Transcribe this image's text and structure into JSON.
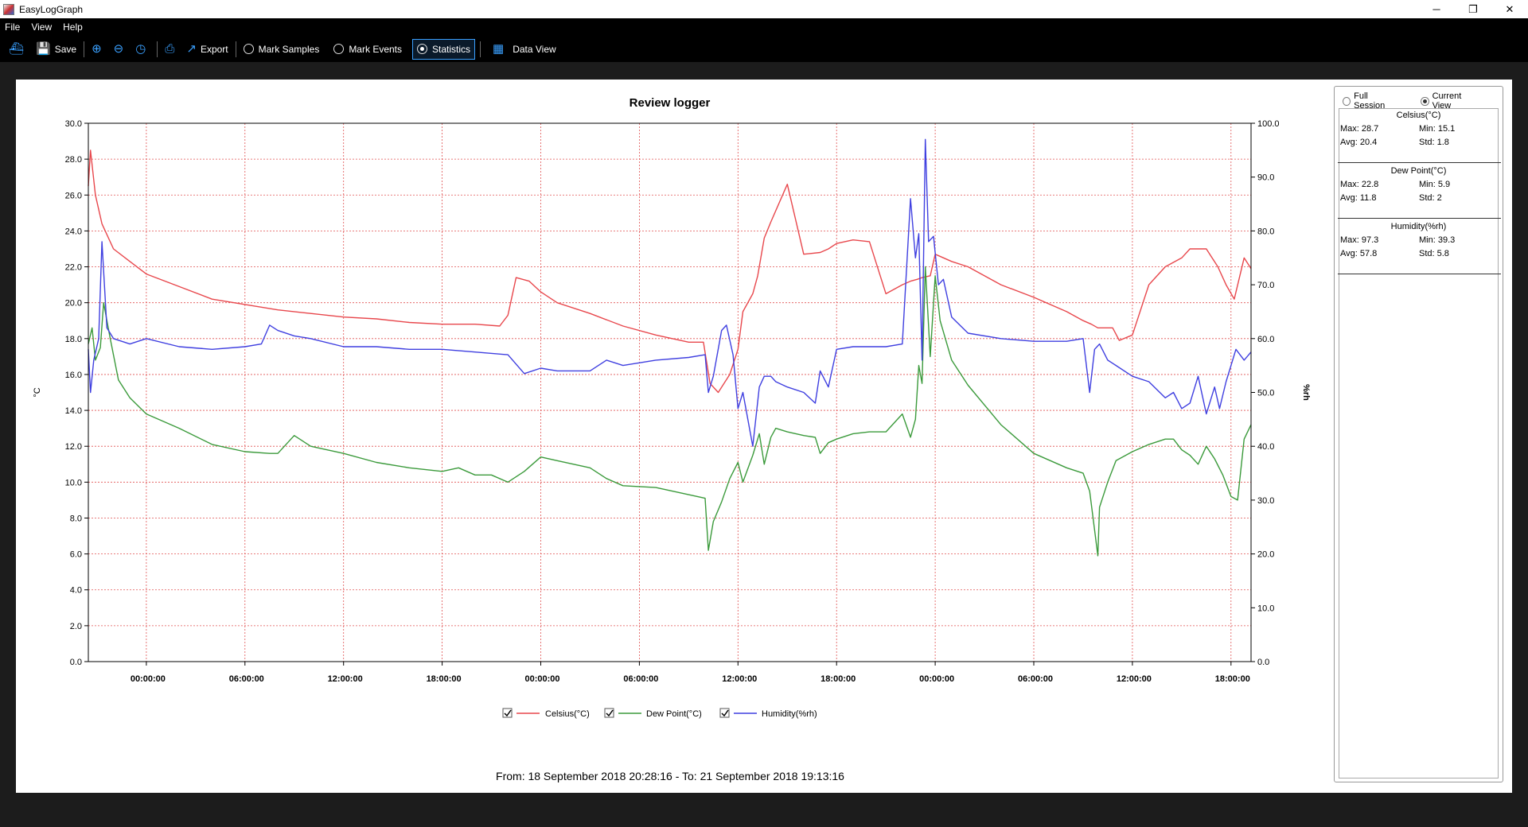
{
  "window": {
    "title": "EasyLogGraph",
    "minimize": "─",
    "restore": "❐",
    "close": "✕"
  },
  "menu": [
    "File",
    "View",
    "Help"
  ],
  "toolbar": {
    "save": "Save",
    "export": "Export",
    "mark_samples": "Mark Samples",
    "mark_events": "Mark Events",
    "statistics": "Statistics",
    "data_view": "Data View"
  },
  "chart_data": {
    "type": "line",
    "title": "Review logger",
    "ylabel": "°C",
    "y2label": "%rh",
    "ylim": [
      0,
      30
    ],
    "y2lim": [
      0,
      100
    ],
    "yticks": [
      "0.0",
      "2.0",
      "4.0",
      "6.0",
      "8.0",
      "10.0",
      "12.0",
      "14.0",
      "16.0",
      "18.0",
      "20.0",
      "22.0",
      "24.0",
      "26.0",
      "28.0",
      "30.0"
    ],
    "y2ticks": [
      "0.0",
      "10.0",
      "20.0",
      "30.0",
      "40.0",
      "50.0",
      "60.0",
      "70.0",
      "80.0",
      "90.0",
      "100.0"
    ],
    "xlim_hours": [
      20.47,
      91.22
    ],
    "xtick_labels": [
      "00:00:00",
      "06:00:00",
      "12:00:00",
      "18:00:00",
      "00:00:00",
      "06:00:00",
      "12:00:00",
      "18:00:00",
      "00:00:00",
      "06:00:00",
      "12:00:00",
      "18:00:00"
    ],
    "xtick_hours": [
      24,
      30,
      36,
      42,
      48,
      54,
      60,
      66,
      72,
      78,
      84,
      90
    ],
    "grid": true,
    "legend_position": "bottom",
    "series": [
      {
        "name": "Celsius(°C)",
        "color": "#e8474c",
        "axis": "left",
        "x": [
          20.47,
          20.6,
          20.9,
          21.3,
          22.0,
          23.0,
          24.0,
          26.0,
          28.0,
          30.0,
          32.0,
          34.0,
          36.0,
          38.0,
          40.0,
          42.0,
          44.0,
          45.5,
          46.0,
          46.5,
          47.3,
          48.0,
          49.0,
          51.0,
          53.0,
          55.0,
          57.0,
          57.9,
          58.3,
          58.8,
          59.5,
          60.0,
          60.3,
          60.9,
          61.2,
          61.6,
          62.0,
          63.0,
          64.0,
          65.0,
          65.5,
          66.0,
          67.0,
          68.0,
          69.0,
          70.0,
          70.5,
          70.9,
          71.2,
          71.7,
          72.0,
          73.0,
          74.0,
          76.0,
          78.0,
          80.0,
          81.0,
          81.5,
          81.9,
          82.3,
          82.8,
          83.2,
          84.0,
          85.0,
          86.0,
          87.0,
          87.5,
          88.0,
          88.5,
          89.2,
          89.7,
          90.2,
          90.8,
          91.22
        ],
        "y": [
          26.5,
          28.5,
          26.0,
          24.4,
          23.0,
          22.3,
          21.6,
          20.9,
          20.2,
          19.9,
          19.6,
          19.4,
          19.2,
          19.1,
          18.9,
          18.8,
          18.8,
          18.7,
          19.3,
          21.4,
          21.2,
          20.6,
          20.0,
          19.4,
          18.7,
          18.2,
          17.8,
          17.8,
          15.5,
          15.0,
          16.0,
          17.4,
          19.5,
          20.5,
          21.5,
          23.6,
          24.5,
          26.6,
          22.7,
          22.8,
          23.0,
          23.3,
          23.5,
          23.4,
          20.5,
          21.0,
          21.2,
          21.3,
          21.4,
          21.5,
          22.7,
          22.3,
          22.0,
          21.0,
          20.3,
          19.5,
          19.0,
          18.8,
          18.6,
          18.6,
          18.6,
          17.9,
          18.2,
          21.0,
          22.0,
          22.5,
          23.0,
          23.0,
          23.0,
          22.0,
          21.0,
          20.2,
          22.5,
          21.9
        ]
      },
      {
        "name": "Dew Point(°C)",
        "color": "#3b9a3b",
        "axis": "left",
        "x": [
          20.47,
          20.7,
          20.9,
          21.2,
          21.4,
          21.8,
          22.3,
          23.0,
          24.0,
          26.0,
          28.0,
          30.0,
          31.5,
          32.0,
          33.0,
          34.0,
          36.0,
          38.0,
          40.0,
          42.0,
          43.0,
          44.0,
          45.0,
          46.0,
          47.0,
          48.0,
          49.0,
          51.0,
          52.0,
          53.0,
          55.0,
          57.0,
          58.0,
          58.2,
          58.5,
          59.0,
          59.5,
          60.0,
          60.3,
          60.9,
          61.3,
          61.6,
          62.0,
          62.3,
          63.0,
          64.0,
          64.7,
          65.0,
          65.5,
          66.0,
          67.0,
          68.0,
          69.0,
          70.0,
          70.5,
          70.8,
          71.0,
          71.2,
          71.4,
          71.7,
          72.0,
          72.3,
          73.0,
          74.0,
          76.0,
          78.0,
          80.0,
          81.0,
          81.4,
          81.9,
          82.0,
          82.5,
          83.0,
          84.0,
          85.0,
          86.0,
          86.5,
          87.0,
          87.5,
          88.0,
          88.5,
          89.0,
          89.5,
          90.0,
          90.4,
          90.8,
          91.22
        ],
        "y": [
          17.7,
          18.6,
          16.8,
          17.5,
          20.0,
          18.0,
          15.7,
          14.7,
          13.8,
          13.0,
          12.1,
          11.7,
          11.6,
          11.6,
          12.6,
          12.0,
          11.6,
          11.1,
          10.8,
          10.6,
          10.8,
          10.4,
          10.4,
          10.0,
          10.6,
          11.4,
          11.2,
          10.8,
          10.2,
          9.8,
          9.7,
          9.3,
          9.1,
          6.2,
          7.8,
          8.9,
          10.2,
          11.1,
          10.0,
          11.5,
          12.7,
          11.0,
          12.5,
          13.0,
          12.8,
          12.6,
          12.5,
          11.6,
          12.2,
          12.4,
          12.7,
          12.8,
          12.8,
          13.8,
          12.5,
          13.5,
          16.5,
          15.5,
          22.0,
          17.0,
          21.5,
          19.0,
          16.8,
          15.4,
          13.2,
          11.6,
          10.8,
          10.5,
          9.5,
          5.9,
          8.6,
          10.0,
          11.2,
          11.7,
          12.1,
          12.4,
          12.4,
          11.8,
          11.5,
          11.0,
          12.0,
          11.3,
          10.4,
          9.2,
          9.0,
          12.4,
          13.2
        ]
      },
      {
        "name": "Humidity(%rh)",
        "color": "#3f3fe0",
        "axis": "right",
        "x": [
          20.47,
          20.6,
          20.8,
          21.1,
          21.3,
          21.6,
          22.0,
          23.0,
          24.0,
          26.0,
          28.0,
          30.0,
          31.0,
          31.5,
          32.0,
          33.0,
          34.0,
          36.0,
          38.0,
          40.0,
          42.0,
          44.0,
          46.0,
          47.0,
          48.0,
          49.0,
          51.0,
          52.0,
          53.0,
          55.0,
          57.0,
          58.0,
          58.2,
          58.5,
          59.0,
          59.3,
          59.7,
          60.0,
          60.3,
          60.9,
          61.3,
          61.6,
          62.0,
          62.3,
          63.0,
          64.0,
          64.7,
          65.0,
          65.5,
          66.0,
          67.0,
          68.0,
          69.0,
          70.0,
          70.5,
          70.8,
          71.0,
          71.2,
          71.4,
          71.6,
          71.9,
          72.2,
          72.5,
          73.0,
          74.0,
          76.0,
          78.0,
          80.0,
          81.0,
          81.4,
          81.7,
          82.0,
          82.5,
          83.0,
          84.0,
          85.0,
          86.0,
          86.5,
          87.0,
          87.5,
          88.0,
          88.5,
          89.0,
          89.3,
          89.7,
          90.3,
          90.8,
          91.22
        ],
        "y": [
          58.0,
          50.0,
          56.0,
          60.0,
          78.0,
          62.0,
          60.0,
          59.0,
          60.0,
          58.5,
          58.0,
          58.5,
          59.0,
          62.5,
          61.5,
          60.5,
          60.0,
          58.5,
          58.5,
          58.0,
          58.0,
          57.5,
          57.0,
          53.5,
          54.5,
          54.0,
          54.0,
          56.0,
          55.0,
          56.0,
          56.5,
          57.0,
          50.0,
          53.0,
          61.5,
          62.5,
          57.0,
          47.0,
          50.0,
          40.0,
          51.0,
          53.0,
          53.0,
          52.0,
          51.0,
          50.0,
          48.0,
          54.0,
          51.0,
          58.0,
          58.5,
          58.5,
          58.5,
          59.0,
          86.0,
          75.0,
          79.5,
          56.0,
          97.0,
          78.0,
          79.0,
          70.0,
          71.0,
          64.0,
          61.0,
          60.0,
          59.5,
          59.5,
          60.0,
          50.0,
          58.0,
          59.0,
          56.0,
          55.0,
          53.0,
          52.0,
          49.0,
          50.0,
          47.0,
          48.0,
          53.0,
          46.0,
          51.0,
          47.0,
          52.0,
          58.0,
          56.0,
          57.5
        ]
      }
    ]
  },
  "legend": {
    "celsius": "Celsius(°C)",
    "dewpoint": "Dew Point(°C)",
    "humidity": "Humidity(%rh)"
  },
  "range_text": "From: 18 September 2018 20:28:16  -  To: 21 September 2018 19:13:16",
  "stats": {
    "full_session": "Full Session",
    "current_view": "Current View",
    "celsius": {
      "title": "Celsius(°C)",
      "max": "Max: 28.7",
      "min": "Min: 15.1",
      "avg": "Avg: 20.4",
      "std": "Std: 1.8"
    },
    "dewpoint": {
      "title": "Dew Point(°C)",
      "max": "Max: 22.8",
      "min": "Min: 5.9",
      "avg": "Avg: 11.8",
      "std": "Std: 2"
    },
    "humidity": {
      "title": "Humidity(%rh)",
      "max": "Max: 97.3",
      "min": "Min: 39.3",
      "avg": "Avg: 57.8",
      "std": "Std: 5.8"
    }
  }
}
